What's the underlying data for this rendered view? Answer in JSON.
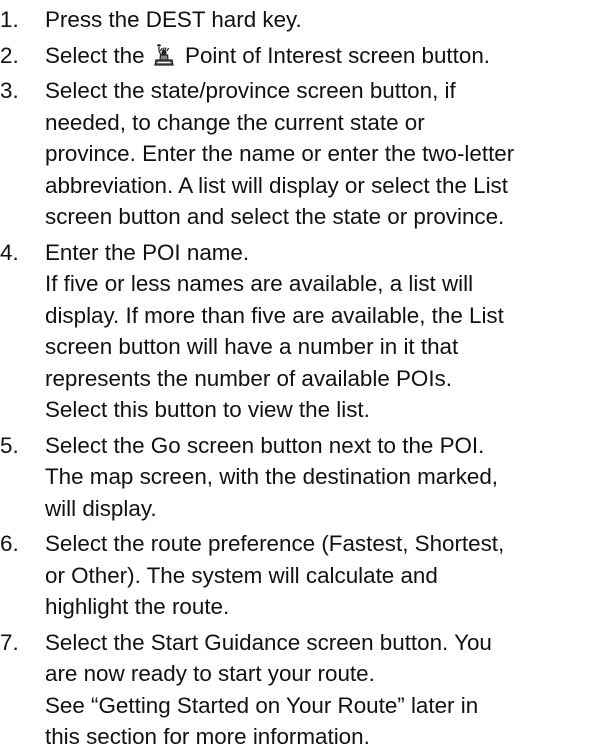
{
  "steps": [
    {
      "number": "1.",
      "lines": [
        "Press the DEST hard key."
      ],
      "sub_lines": []
    },
    {
      "number": "2.",
      "before_icon": "Select the",
      "icon": "statue-of-liberty-icon",
      "after_icon": "Point of Interest screen button.",
      "lines": [],
      "sub_lines": []
    },
    {
      "number": "3.",
      "lines": [
        "Select the state/province screen button, if",
        "needed, to change the current state or",
        "province. Enter the name or enter the two-letter",
        "abbreviation. A list will display or select the List",
        "screen button and select the state or province."
      ],
      "sub_lines": []
    },
    {
      "number": "4.",
      "lines": [
        "Enter the POI name."
      ],
      "sub_lines": [
        "If five or less names are available, a list will",
        "display. If more than five are available, the List",
        "screen button will have a number in it that",
        "represents the number of available POIs.",
        "Select this button to view the list."
      ]
    },
    {
      "number": "5.",
      "lines": [
        "Select the Go screen button next to the POI.",
        "The map screen, with the destination marked,",
        "will display."
      ],
      "sub_lines": []
    },
    {
      "number": "6.",
      "lines": [
        "Select the route preference (Fastest, Shortest,",
        "or Other). The system will calculate and",
        "highlight the route."
      ],
      "sub_lines": []
    },
    {
      "number": "7.",
      "lines": [
        "Select the Start Guidance screen button. You",
        "are now ready to start your route."
      ],
      "sub_lines": [
        "See “Getting Started on Your Route” later in",
        "this section for more information."
      ]
    }
  ]
}
